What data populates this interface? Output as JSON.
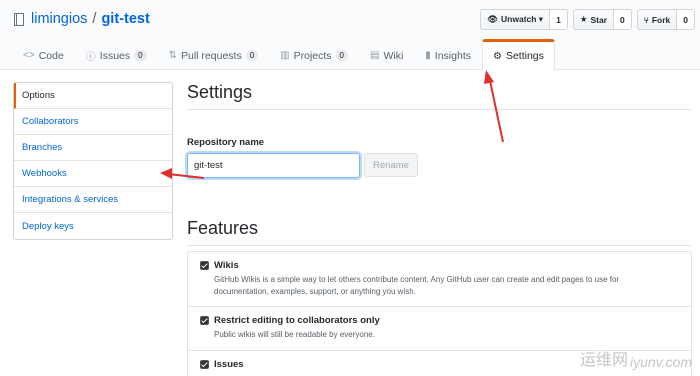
{
  "repo": {
    "owner": "limingios",
    "separator": "/",
    "name": "git-test"
  },
  "actions": {
    "unwatch": {
      "label": "Unwatch ▾",
      "count": "1"
    },
    "star": {
      "label": "Star",
      "count": "0"
    },
    "fork": {
      "label": "Fork",
      "count": "0"
    }
  },
  "tabs": [
    {
      "label": "Code",
      "icon": "code-icon"
    },
    {
      "label": "Issues",
      "count": "0",
      "icon": "issue-icon"
    },
    {
      "label": "Pull requests",
      "count": "0",
      "icon": "pull-request-icon"
    },
    {
      "label": "Projects",
      "count": "0",
      "icon": "project-icon"
    },
    {
      "label": "Wiki",
      "icon": "book-icon"
    },
    {
      "label": "Insights",
      "icon": "graph-icon"
    },
    {
      "label": "Settings",
      "icon": "gear-icon",
      "selected": true
    }
  ],
  "menu": [
    "Options",
    "Collaborators",
    "Branches",
    "Webhooks",
    "Integrations & services",
    "Deploy keys"
  ],
  "settings": {
    "title": "Settings",
    "repo_name_label": "Repository name",
    "repo_name_value": "git-test",
    "rename_label": "Rename"
  },
  "features": {
    "title": "Features",
    "items": [
      {
        "title": "Wikis",
        "desc": "GitHub Wikis is a simple way to let others contribute content. Any GitHub user can create and edit pages to use for documentation, examples, support, or anything you wish."
      },
      {
        "title": "Restrict editing to collaborators only",
        "desc": "Public wikis will still be readable by everyone."
      },
      {
        "title": "Issues",
        "desc": ""
      }
    ]
  },
  "watermark": {
    "zh": "运维网",
    "url": "iyunv.com"
  },
  "colors": {
    "accent": "#e36209",
    "link": "#0366d6",
    "annotation": "#e0302a"
  }
}
